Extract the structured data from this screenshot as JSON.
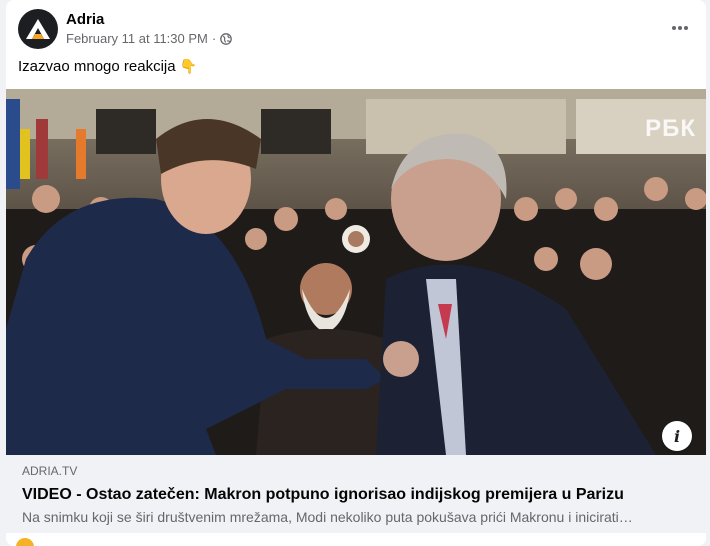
{
  "post": {
    "page_name": "Adria",
    "timestamp": "February 11 at 11:30 PM",
    "separator": "·",
    "privacy_icon": "globe-icon",
    "more_icon": "more-horizontal-icon",
    "caption_text": "Izazvao mnogo reakcija",
    "caption_emoji": "👇"
  },
  "media": {
    "watermark": "РБК",
    "info_label": "i"
  },
  "link_preview": {
    "domain": "ADRIA.TV",
    "headline": "VIDEO - Ostao zatečen: Makron potpuno ignorisao indijskog premijera u Parizu",
    "description": "Na snimku koji se širi društvenim mrežama, Modi nekoliko puta pokušava prići Makronu i inicirati…"
  },
  "colors": {
    "text_primary": "#050505",
    "text_secondary": "#65676b",
    "preview_background": "#f0f2f5",
    "avatar_background": "#1c1e21",
    "logo_accent": "#f5a623"
  }
}
